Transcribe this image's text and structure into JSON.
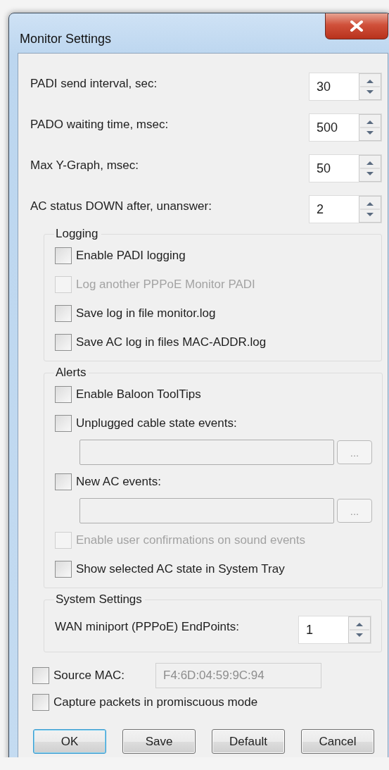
{
  "window": {
    "title": "Monitor Settings"
  },
  "spinners": [
    {
      "label": "PADI send interval, sec:",
      "value": "30"
    },
    {
      "label": "PADO waiting time, msec:",
      "value": "500"
    },
    {
      "label": "Max Y-Graph, msec:",
      "value": "50"
    },
    {
      "label": "AC status DOWN after, unanswer:",
      "value": "2"
    }
  ],
  "groups": [
    {
      "title": "Logging",
      "items": [
        {
          "kind": "checkbox",
          "label": "Enable PADI logging",
          "checked": false,
          "disabled": false
        },
        {
          "kind": "checkbox",
          "label": "Log another PPPoE Monitor PADI",
          "checked": false,
          "disabled": true
        },
        {
          "kind": "checkbox",
          "label": "Save log in file monitor.log",
          "checked": false,
          "disabled": false
        },
        {
          "kind": "checkbox",
          "label": "Save AC log in files MAC-ADDR.log",
          "checked": false,
          "disabled": false
        }
      ]
    },
    {
      "title": "Alerts",
      "items": [
        {
          "kind": "checkbox",
          "label": "Enable Baloon ToolTips",
          "checked": false,
          "disabled": false
        },
        {
          "kind": "checkbox",
          "label": "Unplugged cable state events:",
          "checked": false,
          "disabled": false
        },
        {
          "kind": "file",
          "browse": "..."
        },
        {
          "kind": "checkbox",
          "label": "New AC events:",
          "checked": false,
          "disabled": false
        },
        {
          "kind": "file",
          "browse": "..."
        },
        {
          "kind": "checkbox",
          "label": "Enable user confirmations on sound events",
          "checked": false,
          "disabled": true
        },
        {
          "kind": "checkbox",
          "label": "Show selected AC state in System Tray",
          "checked": false,
          "disabled": false
        }
      ]
    },
    {
      "title": "System Settings",
      "items": [
        {
          "kind": "spinner",
          "label": "WAN miniport (PPPoE) EndPoints:",
          "value": "1"
        }
      ]
    }
  ],
  "bottom": [
    {
      "kind": "checkbox_field",
      "label": "Source MAC:",
      "checked": false,
      "value": "F4:6D:04:59:9C:94",
      "disabled": true
    },
    {
      "kind": "checkbox",
      "label": "Capture packets in promiscuous mode",
      "checked": false,
      "disabled": false
    }
  ],
  "buttons": [
    {
      "label": "OK",
      "default": true
    },
    {
      "label": "Save",
      "default": false
    },
    {
      "label": "Default",
      "default": false
    },
    {
      "label": "Cancel",
      "default": false
    }
  ]
}
